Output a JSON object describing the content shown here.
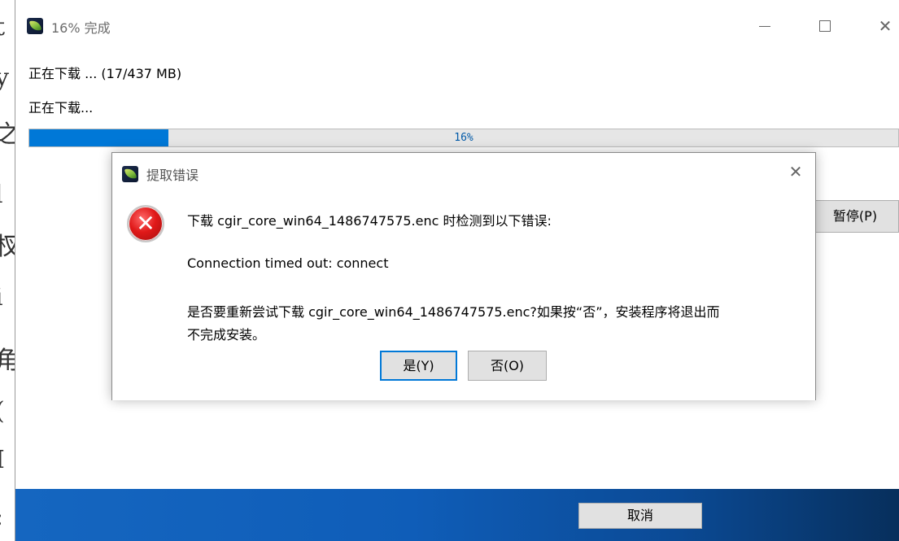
{
  "background": {
    "chars": [
      "t",
      "y",
      "之",
      "l",
      "杈",
      "i",
      "角",
      "(",
      "I",
      ":"
    ]
  },
  "window": {
    "title": "16% 完成",
    "status_line1": "正在下载 ... (17/437 MB)",
    "status_line2": "正在下载...",
    "progress": {
      "percent": 16,
      "label": "16%",
      "fill_color": "#0078d7"
    },
    "pause_label": "暂停(P)",
    "cancel_label": "取消",
    "minimize_icon": "minimize-icon",
    "maximize_icon": "maximize-icon",
    "close_icon": "close-icon"
  },
  "dialog": {
    "title": "提取错误",
    "message_line1": "下载 cgir_core_win64_1486747575.enc 时检测到以下错误:",
    "message_line2": "Connection timed out: connect",
    "message_line3": "是否要重新尝试下载 cgir_core_win64_1486747575.enc?如果按“否”，安装程序将退出而",
    "message_line4": "不完成安装。",
    "yes_label": "是(Y)",
    "no_label": "否(O)",
    "error_icon": "error-icon",
    "error_color": "#e01919"
  }
}
